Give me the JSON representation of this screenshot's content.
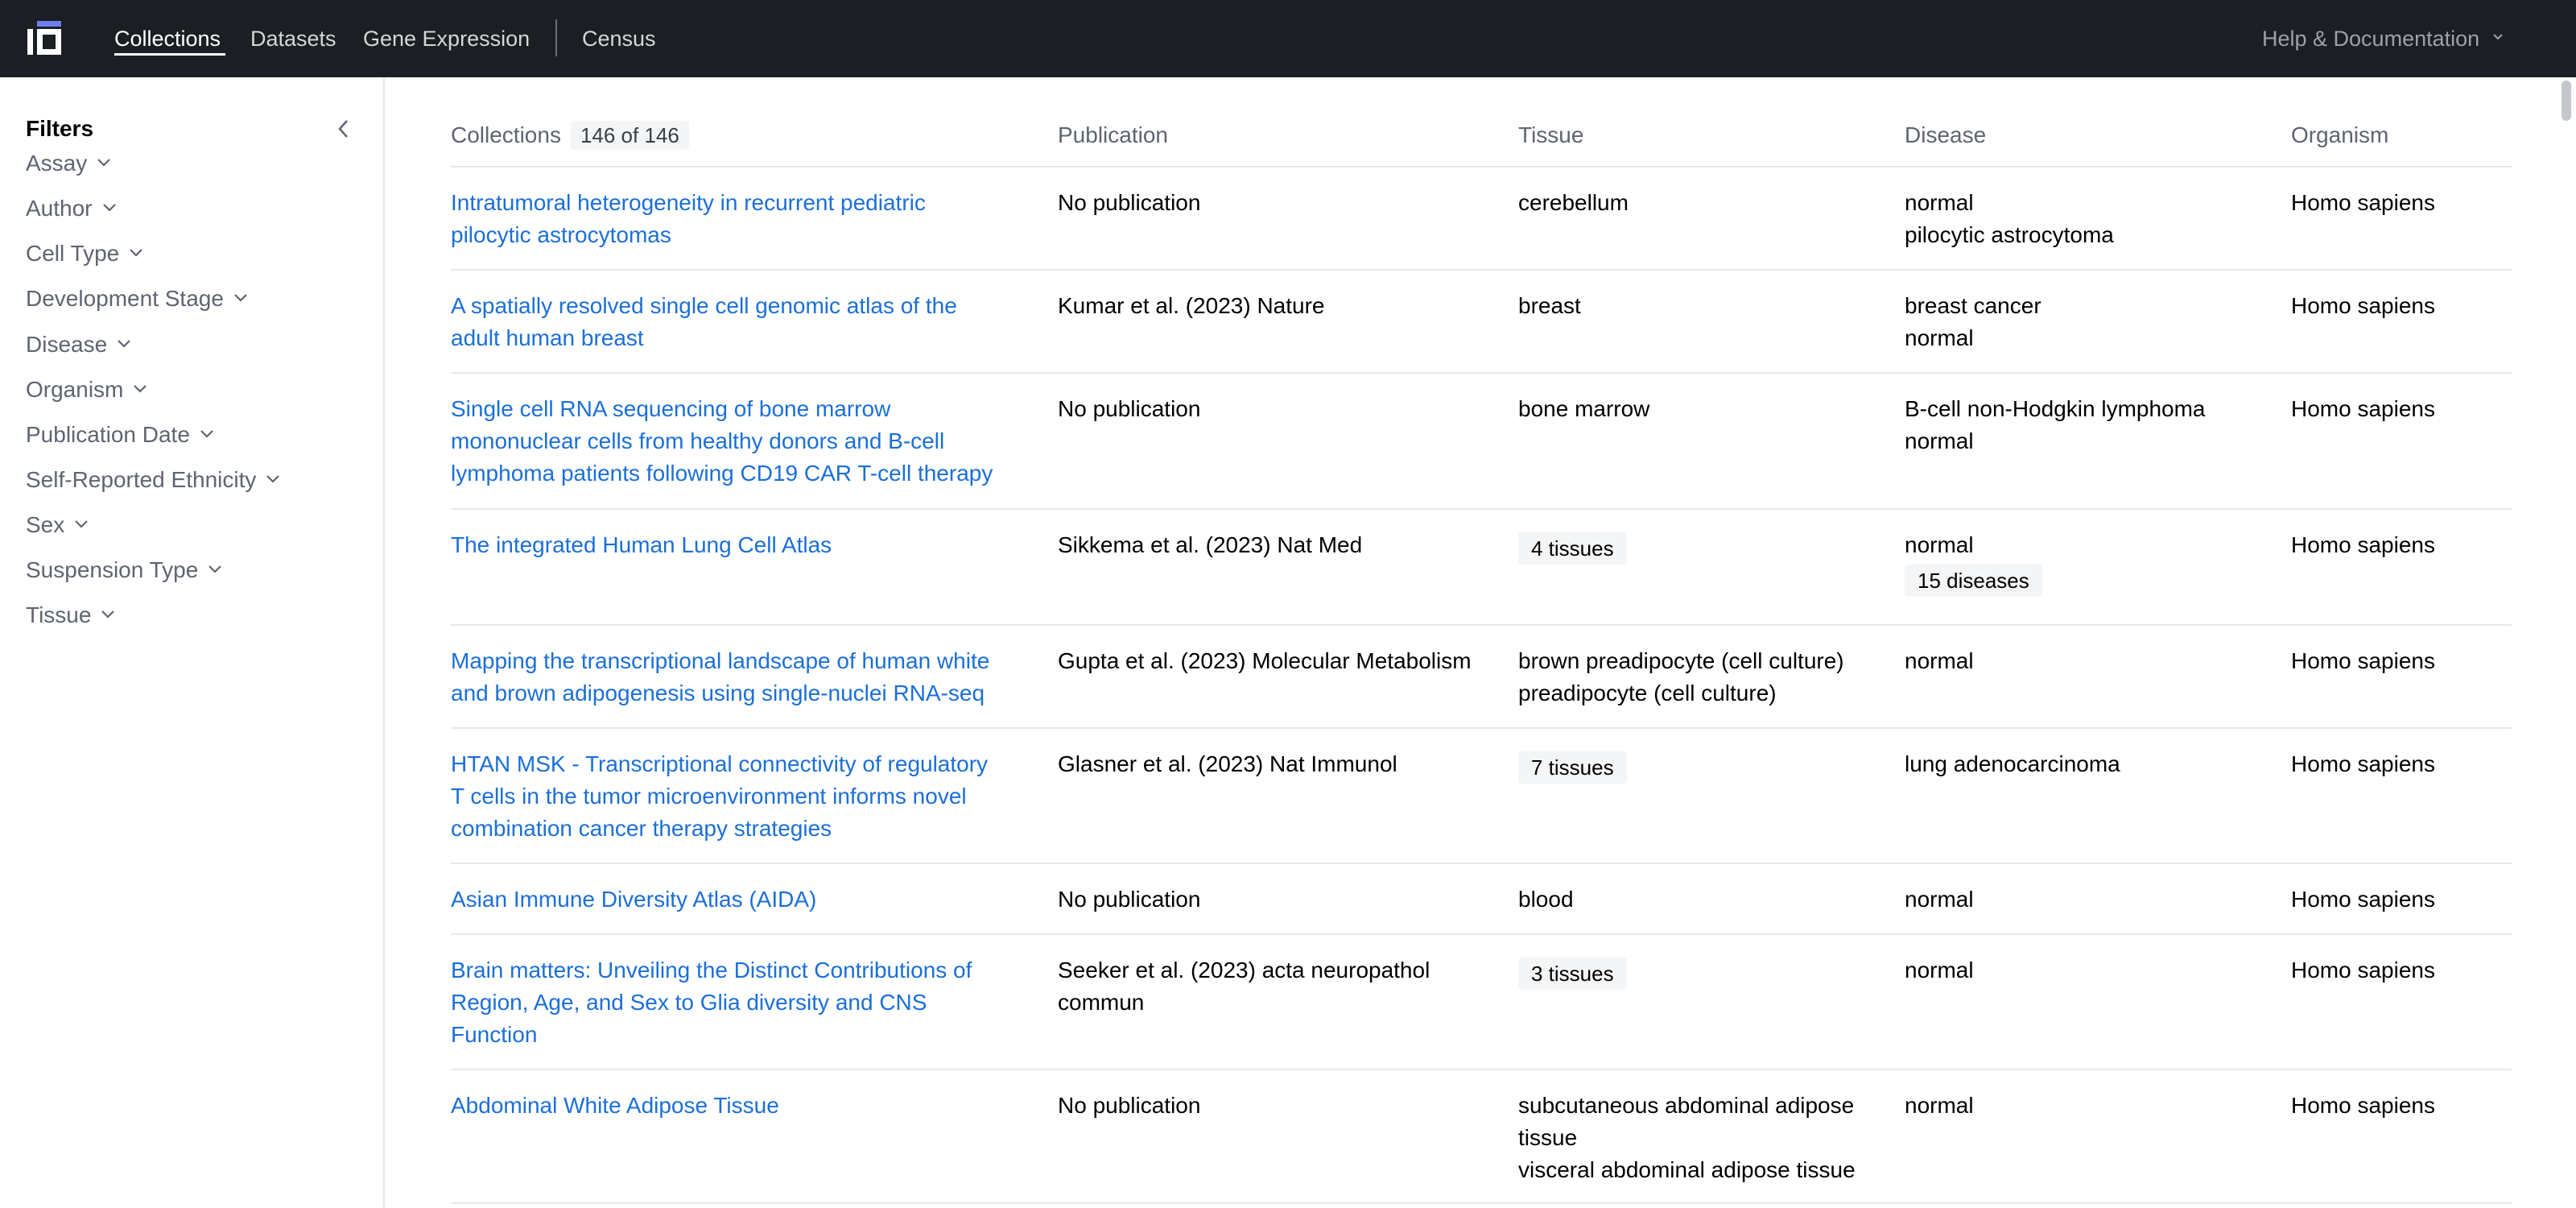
{
  "nav": {
    "links": [
      "Collections",
      "Datasets",
      "Gene Expression",
      "Census"
    ],
    "help": "Help & Documentation"
  },
  "sidebar": {
    "title": "Filters",
    "filters": [
      "Assay",
      "Author",
      "Cell Type",
      "Development Stage",
      "Disease",
      "Organism",
      "Publication Date",
      "Self-Reported Ethnicity",
      "Sex",
      "Suspension Type",
      "Tissue"
    ]
  },
  "table": {
    "headers": {
      "collections": "Collections",
      "count": "146 of 146",
      "publication": "Publication",
      "tissue": "Tissue",
      "disease": "Disease",
      "organism": "Organism"
    },
    "rows": [
      {
        "collection": [
          "Intratumoral heterogeneity in recurrent pediatric",
          "pilocytic astrocytomas"
        ],
        "publication": [
          "No publication"
        ],
        "tissue": [
          "cerebellum"
        ],
        "disease": [
          "normal",
          "pilocytic astrocytoma"
        ],
        "organism": "Homo sapiens"
      },
      {
        "collection": [
          "A spatially resolved single cell genomic atlas of the",
          "adult human breast"
        ],
        "publication": [
          "Kumar et al. (2023) Nature"
        ],
        "tissue": [
          "breast"
        ],
        "disease": [
          "breast cancer",
          "normal"
        ],
        "organism": "Homo sapiens"
      },
      {
        "collection": [
          "Single cell RNA sequencing of bone marrow",
          "mononuclear cells from healthy donors and B-cell",
          "lymphoma patients following CD19 CAR T-cell therapy"
        ],
        "publication": [
          "No publication"
        ],
        "tissue": [
          "bone marrow"
        ],
        "disease": [
          "B-cell non-Hodgkin lymphoma",
          "normal"
        ],
        "organism": "Homo sapiens"
      },
      {
        "collection": [
          "The integrated Human Lung Cell Atlas"
        ],
        "publication": [
          "Sikkema et al. (2023) Nat Med"
        ],
        "tissue_pill": "4 tissues",
        "disease": [
          "normal"
        ],
        "disease_pill": "15 diseases",
        "organism": "Homo sapiens"
      },
      {
        "collection": [
          "Mapping the transcriptional landscape of human white",
          "and brown adipogenesis using single-nuclei RNA-seq"
        ],
        "publication": [
          "Gupta et al. (2023) Molecular Metabolism"
        ],
        "tissue": [
          "brown preadipocyte (cell culture)",
          "preadipocyte (cell culture)"
        ],
        "disease": [
          "normal"
        ],
        "organism": "Homo sapiens"
      },
      {
        "collection": [
          "HTAN MSK - Transcriptional connectivity of regulatory",
          "T cells in the tumor microenvironment informs novel",
          "combination cancer therapy strategies"
        ],
        "publication": [
          "Glasner et al. (2023) Nat Immunol"
        ],
        "tissue_pill": "7 tissues",
        "disease": [
          "lung adenocarcinoma"
        ],
        "organism": "Homo sapiens"
      },
      {
        "collection": [
          "Asian Immune Diversity Atlas (AIDA)"
        ],
        "publication": [
          "No publication"
        ],
        "tissue": [
          "blood"
        ],
        "disease": [
          "normal"
        ],
        "organism": "Homo sapiens"
      },
      {
        "collection": [
          "Brain matters: Unveiling the Distinct Contributions of",
          "Region, Age, and Sex to Glia diversity and CNS",
          "Function"
        ],
        "publication": [
          "Seeker et al. (2023) acta neuropathol",
          "commun"
        ],
        "tissue_pill": "3 tissues",
        "disease": [
          "normal"
        ],
        "organism": "Homo sapiens"
      },
      {
        "collection": [
          "Abdominal White Adipose Tissue"
        ],
        "publication": [
          "No publication"
        ],
        "tissue": [
          "subcutaneous abdominal adipose",
          "tissue",
          "visceral abdominal adipose tissue"
        ],
        "disease": [
          "normal"
        ],
        "organism": "Homo sapiens"
      }
    ]
  }
}
